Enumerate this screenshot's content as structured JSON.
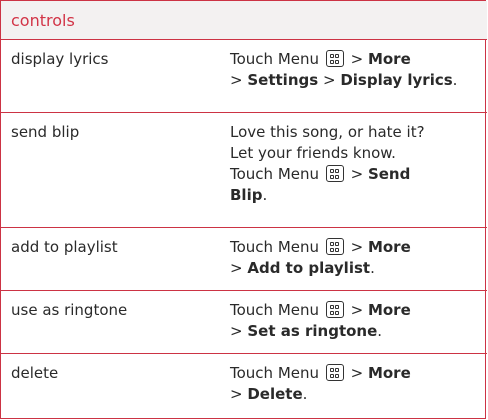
{
  "header": {
    "title": "controls"
  },
  "rows": [
    {
      "name": "display lyrics",
      "touch": "Touch Menu",
      "gt": ">",
      "p1": "More",
      "p2": "Settings",
      "p3": "Display lyrics",
      "end": "."
    },
    {
      "name": "send blip",
      "line1": "Love this song, or hate it?",
      "line2": "Let your friends know.",
      "touch": "Touch Menu",
      "gt": ">",
      "p1": "Send",
      "p2": "Blip",
      "end": "."
    },
    {
      "name": "add to playlist",
      "touch": "Touch Menu",
      "gt": ">",
      "p1": "More",
      "p2": "Add to playlist",
      "end": "."
    },
    {
      "name": "use as ringtone",
      "touch": "Touch Menu",
      "gt": ">",
      "p1": "More",
      "p2": "Set as ringtone",
      "end": "."
    },
    {
      "name": "delete",
      "touch": "Touch Menu",
      "gt": ">",
      "p1": "More",
      "p2": "Delete",
      "end": "."
    }
  ],
  "icons": {
    "menu": "menu-key-icon"
  },
  "colors": {
    "accent": "#d23447",
    "border": "#cc3344",
    "header_bg": "#f3f1f1"
  }
}
